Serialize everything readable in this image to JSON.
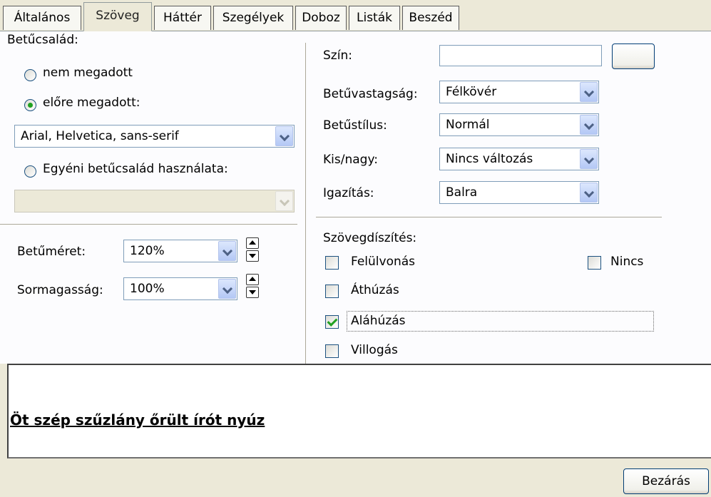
{
  "tabs": [
    {
      "label": "Általános",
      "active": false
    },
    {
      "label": "Szöveg",
      "active": true
    },
    {
      "label": "Háttér",
      "active": false
    },
    {
      "label": "Szegélyek",
      "active": false
    },
    {
      "label": "Doboz",
      "active": false
    },
    {
      "label": "Listák",
      "active": false
    },
    {
      "label": "Beszéd",
      "active": false
    }
  ],
  "font_family": {
    "label": "Betűcsalád:",
    "option_unspecified": "nem megadott",
    "option_predefined": "előre megadott:",
    "predefined_value": "Arial, Helvetica, sans-serif",
    "option_custom": "Egyéni betűcsalád használata:",
    "custom_value": "",
    "selected": "predefined"
  },
  "size": {
    "font_size_label": "Betűméret:",
    "font_size_value": "120%",
    "line_height_label": "Sormagasság:",
    "line_height_value": "100%"
  },
  "right": {
    "color_label": "Szín:",
    "color_value": "",
    "weight_label": "Betűvastagság:",
    "weight_value": "Félkövér",
    "style_label": "Betűstílus:",
    "style_value": "Normál",
    "case_label": "Kis/nagy:",
    "case_value": "Nincs változás",
    "align_label": "Igazítás:",
    "align_value": "Balra"
  },
  "decoration": {
    "label": "Szövegdíszítés:",
    "overline": {
      "label": "Felülvonás",
      "checked": false
    },
    "none": {
      "label": "Nincs",
      "checked": false
    },
    "strike": {
      "label": "Áthúzás",
      "checked": false
    },
    "underline": {
      "label": "Aláhúzás",
      "checked": true
    },
    "blink": {
      "label": "Villogás",
      "checked": false
    }
  },
  "preview": {
    "text": "Öt szép szűzlány őrült írót nyúz"
  },
  "footer": {
    "close_label": "Bezárás"
  }
}
